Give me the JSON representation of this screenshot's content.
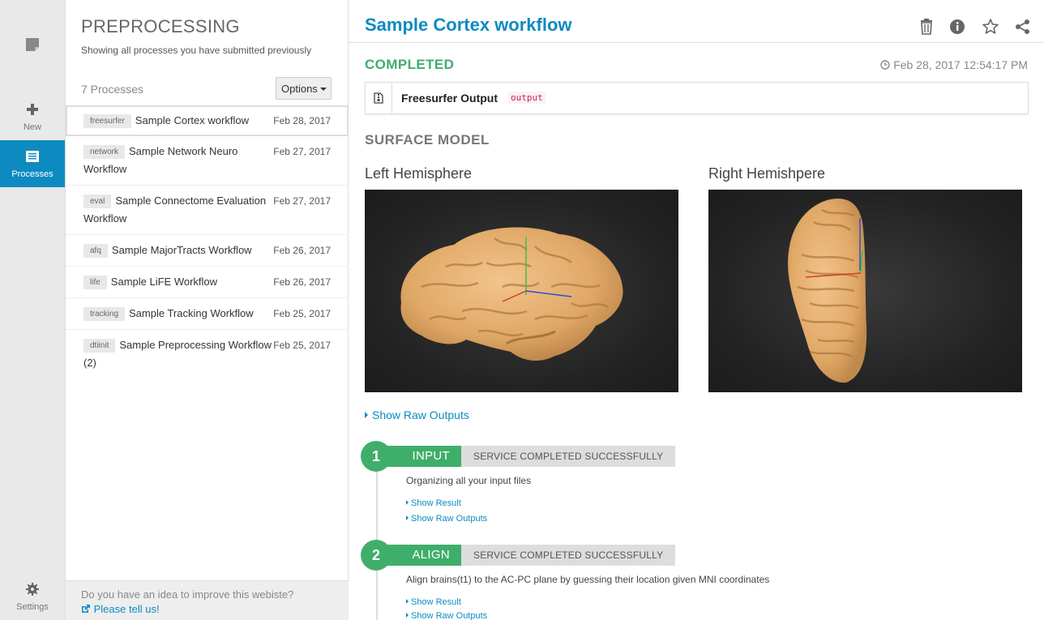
{
  "nav": {
    "items": [
      {
        "label": "New"
      },
      {
        "label": "Processes"
      },
      {
        "label": "Settings"
      }
    ]
  },
  "list": {
    "title": "PREPROCESSING",
    "subtitle": "Showing all processes you have submitted previously",
    "count": "7 Processes",
    "options_label": "Options",
    "rows": [
      {
        "tag": "freesurfer",
        "name": "Sample Cortex workflow",
        "date": "Feb 28, 2017"
      },
      {
        "tag": "network",
        "name": "Sample Network Neuro Workflow",
        "date": "Feb 27, 2017"
      },
      {
        "tag": "eval",
        "name": "Sample Connectome Evaluation Workflow",
        "date": "Feb 27, 2017"
      },
      {
        "tag": "afq",
        "name": "Sample MajorTracts Workflow",
        "date": "Feb 26, 2017"
      },
      {
        "tag": "life",
        "name": "Sample LiFE Workflow",
        "date": "Feb 26, 2017"
      },
      {
        "tag": "tracking",
        "name": "Sample Tracking Workflow",
        "date": "Feb 25, 2017"
      },
      {
        "tag": "dtiinit",
        "name": "Sample Preprocessing Workflow (2)",
        "date": "Feb 25, 2017"
      }
    ],
    "feedback_text": "Do you have an idea to improve this webiste?",
    "feedback_link": "Please tell us!"
  },
  "main": {
    "title": "Sample Cortex workflow",
    "status": "COMPLETED",
    "timestamp": "Feb 28, 2017 12:54:17 PM",
    "output_name": "Freesurfer Output",
    "output_code": "output",
    "section": "SURFACE MODEL",
    "left_label": "Left Hemisphere",
    "right_label": "Right Hemishpere",
    "raw_outputs": "Show Raw Outputs",
    "steps": [
      {
        "num": "1",
        "name": "INPUT",
        "badge": "SERVICE COMPLETED SUCCESSFULLY",
        "desc": "Organizing all your input files",
        "show_result": "Show Result",
        "show_raw": "Show Raw Outputs"
      },
      {
        "num": "2",
        "name": "ALIGN",
        "badge": "SERVICE COMPLETED SUCCESSFULLY",
        "desc": "Align brains(t1) to the AC-PC plane by guessing their location given MNI coordinates",
        "show_result": "Show Result",
        "show_raw": "Show Raw Outputs"
      }
    ]
  },
  "colors": {
    "accent": "#0d8bc1",
    "success": "#3fae6a",
    "brain": "#e8b57a"
  }
}
